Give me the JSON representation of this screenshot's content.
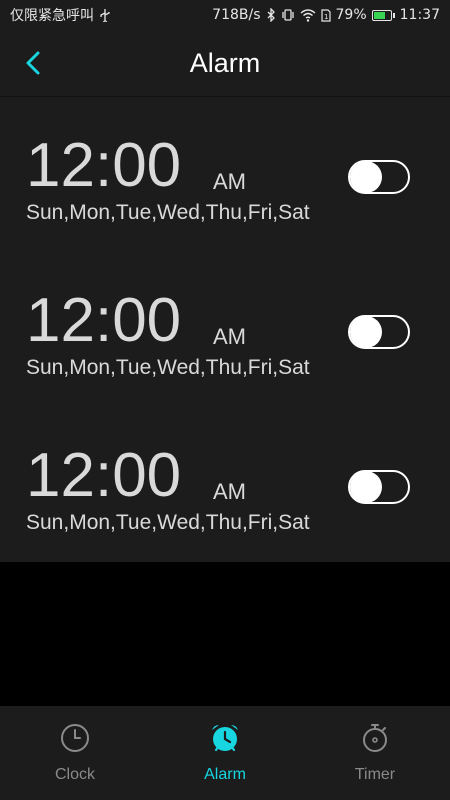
{
  "status_bar": {
    "carrier": "仅限紧急呼叫",
    "network_speed": "718B/s",
    "battery_percent": "79%",
    "battery_level": 0.79,
    "time": "11:37"
  },
  "header": {
    "title": "Alarm"
  },
  "alarms": [
    {
      "time": "12:00",
      "ampm": "AM",
      "days": "Sun,Mon,Tue,Wed,Thu,Fri,Sat",
      "enabled": false
    },
    {
      "time": "12:00",
      "ampm": "AM",
      "days": "Sun,Mon,Tue,Wed,Thu,Fri,Sat",
      "enabled": false
    },
    {
      "time": "12:00",
      "ampm": "AM",
      "days": "Sun,Mon,Tue,Wed,Thu,Fri,Sat",
      "enabled": false
    }
  ],
  "bottom_nav": {
    "items": [
      {
        "label": "Clock",
        "icon": "clock-icon",
        "active": false
      },
      {
        "label": "Alarm",
        "icon": "alarm-clock-icon",
        "active": true
      },
      {
        "label": "Timer",
        "icon": "stopwatch-icon",
        "active": false
      }
    ]
  },
  "colors": {
    "accent": "#18d6e0",
    "background": "#1c1c1c",
    "text": "#d9d9d9",
    "inactive_nav": "#8a8a8a"
  }
}
